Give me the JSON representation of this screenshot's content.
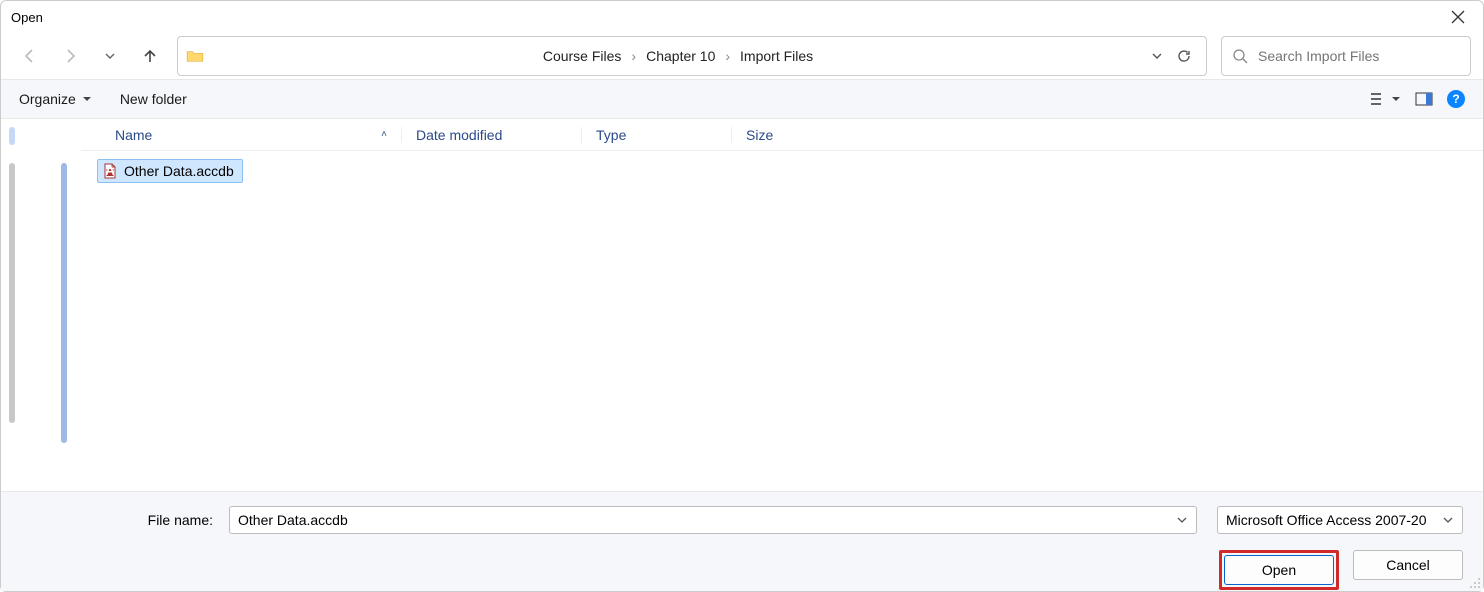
{
  "titlebar": {
    "title": "Open"
  },
  "breadcrumb": {
    "items": [
      "Course Files",
      "Chapter 10",
      "Import Files"
    ]
  },
  "search": {
    "placeholder": "Search Import Files"
  },
  "toolbar": {
    "organize_label": "Organize",
    "newfolder_label": "New folder"
  },
  "columns": {
    "name": "Name",
    "date": "Date modified",
    "type": "Type",
    "size": "Size"
  },
  "files": [
    {
      "name": "Other Data.accdb"
    }
  ],
  "footer": {
    "filename_label": "File name:",
    "filename_value": "Other Data.accdb",
    "filter_label": "Microsoft Office Access 2007-20",
    "open_label": "Open",
    "cancel_label": "Cancel"
  }
}
